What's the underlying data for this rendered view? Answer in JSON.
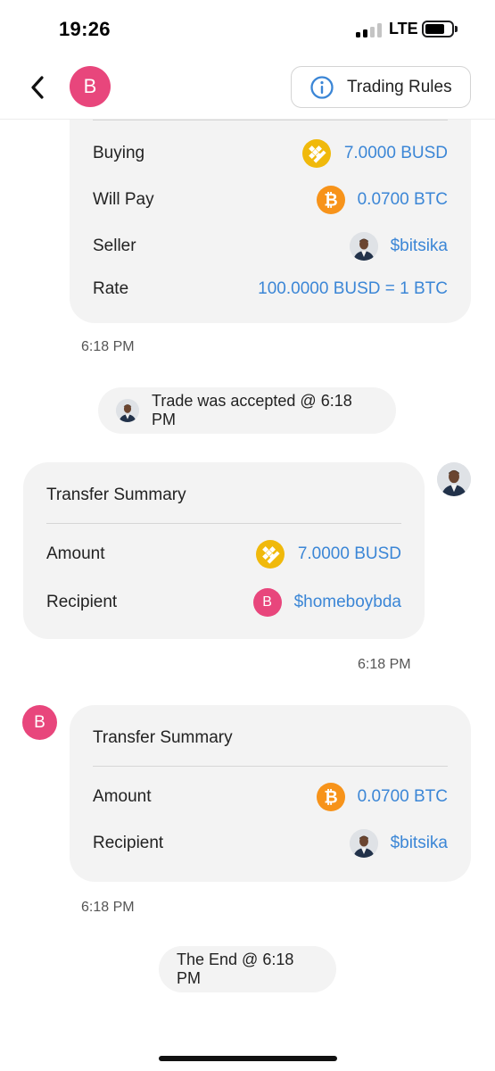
{
  "status_bar": {
    "time": "19:26",
    "network": "LTE",
    "battery_level": 0.75,
    "signal_bars_active": 2,
    "signal_bars_total": 4
  },
  "header": {
    "avatar_letter": "B",
    "trading_rules_label": "Trading Rules"
  },
  "offer_card": {
    "buying_label": "Buying",
    "buying_value": "7.0000 BUSD",
    "pay_label": "Will Pay",
    "pay_value": "0.0700 BTC",
    "seller_label": "Seller",
    "seller_value": "$bitsika",
    "rate_label": "Rate",
    "rate_value": "100.0000 BUSD = 1 BTC",
    "timestamp": "6:18 PM"
  },
  "accepted_notice": {
    "text": "Trade was accepted @ 6:18 PM"
  },
  "transfer_1": {
    "title": "Transfer Summary",
    "amount_label": "Amount",
    "amount_value": "7.0000 BUSD",
    "recipient_label": "Recipient",
    "recipient_value": "$homeboybda",
    "recipient_avatar_letter": "B",
    "timestamp": "6:18 PM"
  },
  "transfer_2": {
    "title": "Transfer Summary",
    "amount_label": "Amount",
    "amount_value": "0.0700 BTC",
    "recipient_label": "Recipient",
    "recipient_value": "$bitsika",
    "sender_avatar_letter": "B",
    "timestamp": "6:18 PM"
  },
  "end_notice": {
    "text": "The End @ 6:18 PM"
  },
  "colors": {
    "accent_link": "#3b86d6",
    "avatar_pink": "#e8467c",
    "busd_yellow": "#f0b90b",
    "btc_orange": "#f7931a",
    "card_bg": "#f3f3f3"
  },
  "icons": [
    "back-chevron-icon",
    "info-icon",
    "busd-coin-icon",
    "btc-coin-icon",
    "user-photo-avatar"
  ]
}
